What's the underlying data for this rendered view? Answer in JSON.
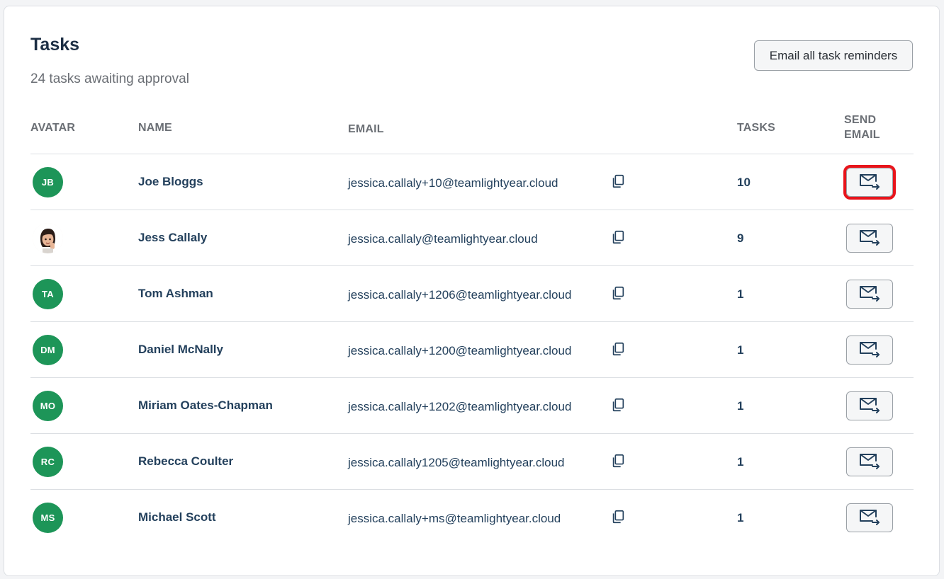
{
  "header": {
    "title": "Tasks",
    "subtitle": "24 tasks awaiting approval",
    "email_all_label": "Email all task reminders"
  },
  "columns": {
    "avatar": "AVATAR",
    "name": "NAME",
    "email": "EMAIL",
    "tasks": "TASKS",
    "send_line1": "SEND",
    "send_line2": "EMAIL"
  },
  "rows": [
    {
      "initials": "JB",
      "name": "Joe Bloggs",
      "email": "jessica.callaly+10@teamlightyear.cloud",
      "tasks": "10",
      "highlighted": true
    },
    {
      "initials": "",
      "name": "Jess Callaly",
      "email": "jessica.callaly@teamlightyear.cloud",
      "tasks": "9",
      "avatar_photo": true
    },
    {
      "initials": "TA",
      "name": "Tom Ashman",
      "email": "jessica.callaly+1206@teamlightyear.cloud",
      "tasks": "1"
    },
    {
      "initials": "DM",
      "name": "Daniel McNally",
      "email": "jessica.callaly+1200@teamlightyear.cloud",
      "tasks": "1"
    },
    {
      "initials": "MO",
      "name": "Miriam Oates-Chapman",
      "email": "jessica.callaly+1202@teamlightyear.cloud",
      "tasks": "1"
    },
    {
      "initials": "RC",
      "name": "Rebecca Coulter",
      "email": "jessica.callaly1205@teamlightyear.cloud",
      "tasks": "1"
    },
    {
      "initials": "MS",
      "name": "Michael Scott",
      "email": "jessica.callaly+ms@teamlightyear.cloud",
      "tasks": "1"
    }
  ],
  "icons": {
    "copy": "copy-icon",
    "send": "mail-send-icon"
  },
  "colors": {
    "avatar_green": "#1d9558",
    "text_navy": "#23405c",
    "highlight_red": "#e8141b"
  }
}
